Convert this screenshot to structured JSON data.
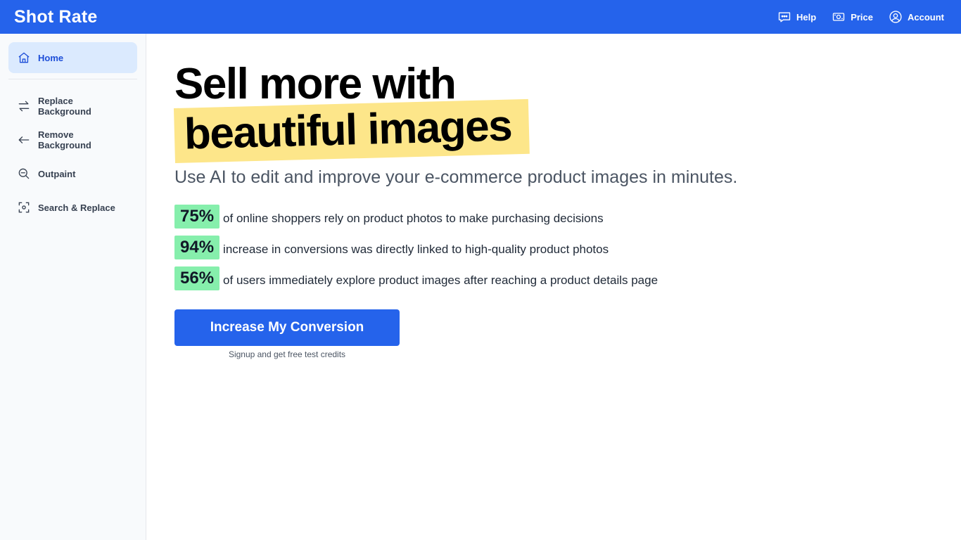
{
  "header": {
    "brand": "Shot Rate",
    "nav": [
      {
        "label": "Help",
        "icon": "chat-icon"
      },
      {
        "label": "Price",
        "icon": "money-icon"
      },
      {
        "label": "Account",
        "icon": "user-circle-icon"
      }
    ]
  },
  "sidebar": {
    "items": [
      {
        "label": "Home",
        "icon": "home-icon",
        "active": true
      },
      {
        "label": "Replace Background",
        "icon": "swap-arrows-icon"
      },
      {
        "label": "Remove Background",
        "icon": "arrow-left-icon"
      },
      {
        "label": "Outpaint",
        "icon": "zoom-out-icon"
      },
      {
        "label": "Search & Replace",
        "icon": "scan-target-icon"
      }
    ]
  },
  "hero": {
    "title_line1": "Sell more with",
    "title_line2": "beautiful images",
    "subtitle": "Use AI to edit and improve your e-commerce product images in minutes."
  },
  "stats": [
    {
      "value": "75%",
      "text": "of online shoppers rely on product photos to make purchasing decisions"
    },
    {
      "value": "94%",
      "text": "increase in conversions was directly linked to high-quality product photos"
    },
    {
      "value": "56%",
      "text": "of users immediately explore product images after reaching a product details page"
    }
  ],
  "cta": {
    "label": "Increase My Conversion",
    "note": "Signup and get free test credits"
  },
  "colors": {
    "primary": "#2563eb",
    "highlight": "#fde68a",
    "stat_badge": "#86efac",
    "sidebar_active": "#dbeafe"
  }
}
